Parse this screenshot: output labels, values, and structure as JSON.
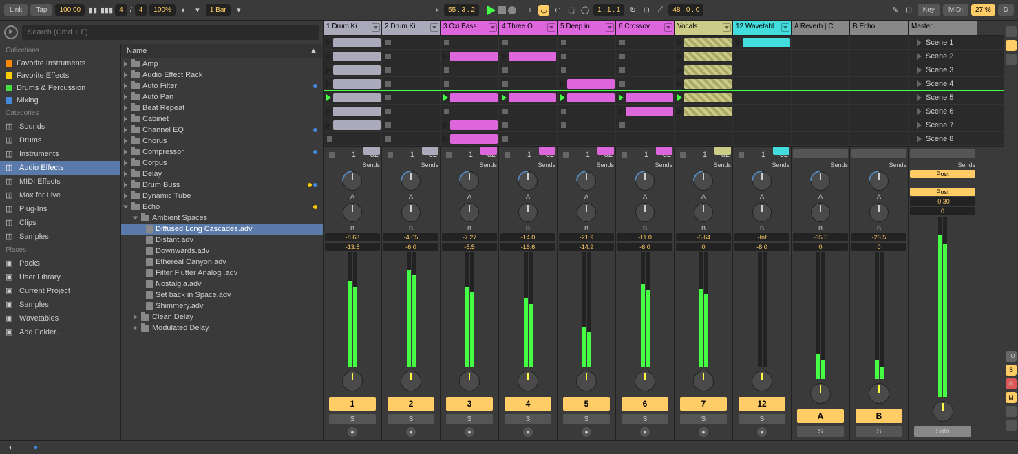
{
  "toolbar": {
    "link": "Link",
    "tap": "Tap",
    "tempo": "100.00",
    "sig_num": "4",
    "sig_sep": "/",
    "sig_den": "4",
    "zoom": "100%",
    "quantize": "1 Bar",
    "position": "55 . 3 . 2",
    "bar_position": "1 . 1 . 1",
    "loop": "48 . 0 . 0",
    "key": "Key",
    "midi": "MIDI",
    "cpu": "27 %",
    "d": "D"
  },
  "search": {
    "placeholder": "Search (Cmd + F)"
  },
  "browser": {
    "collections_header": "Collections",
    "collections": [
      {
        "label": "Favorite Instruments",
        "color": "#f80"
      },
      {
        "label": "Favorite Effects",
        "color": "#fc0"
      },
      {
        "label": "Drums & Percussion",
        "color": "#4d4"
      },
      {
        "label": "Mixing",
        "color": "#48d"
      }
    ],
    "categories_header": "Categories",
    "categories": [
      "Sounds",
      "Drums",
      "Instruments",
      "Audio Effects",
      "MIDI Effects",
      "Max for Live",
      "Plug-Ins",
      "Clips",
      "Samples"
    ],
    "selected_category": "Audio Effects",
    "places_header": "Places",
    "places": [
      "Packs",
      "User Library",
      "Current Project",
      "Samples",
      "Wavetables",
      "Add Folder..."
    ],
    "name_header": "Name",
    "devices": [
      {
        "name": "Amp",
        "dots": []
      },
      {
        "name": "Audio Effect Rack",
        "dots": []
      },
      {
        "name": "Auto Filter",
        "dots": [
          "#48d"
        ]
      },
      {
        "name": "Auto Pan",
        "dots": []
      },
      {
        "name": "Beat Repeat",
        "dots": []
      },
      {
        "name": "Cabinet",
        "dots": []
      },
      {
        "name": "Channel EQ",
        "dots": [
          "#48d"
        ]
      },
      {
        "name": "Chorus",
        "dots": []
      },
      {
        "name": "Compressor",
        "dots": [
          "#48d"
        ]
      },
      {
        "name": "Corpus",
        "dots": []
      },
      {
        "name": "Delay",
        "dots": []
      },
      {
        "name": "Drum Buss",
        "dots": [
          "#fc0",
          "#48d"
        ]
      },
      {
        "name": "Dynamic Tube",
        "dots": []
      },
      {
        "name": "Echo",
        "dots": [
          "#fc0"
        ],
        "open": true
      }
    ],
    "echo_folder": "Ambient Spaces",
    "echo_presets": [
      "Diffused Long Cascades.adv",
      "Distant.adv",
      "Downwards.adv",
      "Ethereal Canyon.adv",
      "Filter Flutter Analog .adv",
      "Nostalgia.adv",
      "Set back in Space.adv",
      "Shimmery.adv"
    ],
    "selected_preset": "Diffused Long Cascades.adv",
    "after_echo": [
      "Clean Delay",
      "Modulated Delay"
    ]
  },
  "tracks": [
    {
      "name": "1 Drum Ki",
      "color": "#aab",
      "num": "1"
    },
    {
      "name": "2 Drum Ki",
      "color": "#aab",
      "num": "2"
    },
    {
      "name": "3 Oxi Bass",
      "color": "#d6d",
      "num": "3"
    },
    {
      "name": "4 Three O",
      "color": "#d6d",
      "num": "4"
    },
    {
      "name": "5 Deep in",
      "color": "#d6d",
      "num": "5"
    },
    {
      "name": "6 Crossov",
      "color": "#d6d",
      "num": "6"
    },
    {
      "name": "Vocals",
      "color": "#cc8",
      "num": "7"
    },
    {
      "name": "12 Wavetabl",
      "color": "#4dd",
      "num": "12"
    }
  ],
  "returns": [
    {
      "name": "A Reverb | C",
      "num": "A"
    },
    {
      "name": "B Echo",
      "num": "B"
    }
  ],
  "master": {
    "name": "Master"
  },
  "scenes": [
    "Scene 1",
    "Scene 2",
    "Scene 3",
    "Scene 4",
    "Scene 5",
    "Scene 6",
    "Scene 7",
    "Scene 8"
  ],
  "clip_grid": [
    [
      {
        "c": "#aab"
      },
      {
        "s": true
      },
      {
        "s": true
      },
      {
        "s": true
      },
      {
        "s": true
      },
      {
        "s": true
      },
      {
        "h": true
      },
      {
        "cy": true
      },
      null,
      null
    ],
    [
      {
        "c": "#aab"
      },
      {
        "s": true
      },
      {
        "c": "#d6d"
      },
      {
        "c": "#d6d"
      },
      {
        "s": true
      },
      {
        "s": true
      },
      {
        "h": true
      },
      {
        "e": true
      },
      null,
      null
    ],
    [
      {
        "c": "#aab"
      },
      {
        "s": true
      },
      {
        "s": true
      },
      {
        "s": true
      },
      {
        "s": true
      },
      {
        "s": true
      },
      {
        "h": true
      },
      {
        "e": true
      },
      null,
      null
    ],
    [
      {
        "c": "#aab"
      },
      {
        "s": true
      },
      {
        "s": true
      },
      {
        "s": true
      },
      {
        "c": "#d6d"
      },
      {
        "s": true
      },
      {
        "h": true
      },
      {
        "e": true
      },
      null,
      null
    ],
    [
      {
        "c": "#aab",
        "p": true
      },
      {
        "p": true,
        "s": true
      },
      {
        "c": "#d6d",
        "p": true
      },
      {
        "c": "#d6d",
        "p": true
      },
      {
        "c": "#d6d",
        "p": true
      },
      {
        "c": "#d6d",
        "p": true
      },
      {
        "h": true,
        "p": true
      },
      {
        "e": true
      },
      null,
      null
    ],
    [
      {
        "c": "#aab"
      },
      {
        "s": true
      },
      {
        "s": true
      },
      {
        "s": true
      },
      {
        "s": true
      },
      {
        "c": "#d6d"
      },
      {
        "h": true
      },
      {
        "e": true
      },
      null,
      null
    ],
    [
      {
        "c": "#aab"
      },
      {
        "s": true
      },
      {
        "c": "#d6d"
      },
      {
        "s": true
      },
      {
        "s": true
      },
      {
        "s": true
      },
      {
        "e": true
      },
      {
        "e": true
      },
      null,
      null
    ],
    [
      {
        "s": true
      },
      {
        "s": true
      },
      {
        "c": "#d6d"
      },
      {
        "s": true
      },
      {
        "e": true
      },
      {
        "e": true
      },
      {
        "e": true
      },
      {
        "e": true
      },
      null,
      null
    ]
  ],
  "mixer": {
    "loop_label": "32",
    "loop_num": "1",
    "sends_label": "Sends",
    "send_a": "A",
    "send_b": "B",
    "s_label": "S",
    "solo_label": "Solo",
    "post_label": "Post",
    "tracks": [
      {
        "vol": "-8.63",
        "send": "-13.5",
        "meter": 75,
        "marker": "#aab"
      },
      {
        "vol": "-4.65",
        "send": "-6.0",
        "meter": 85,
        "marker": "#aab"
      },
      {
        "vol": "-7.27",
        "send": "-5.5",
        "meter": 70,
        "marker": "#d6d"
      },
      {
        "vol": "-14.0",
        "send": "-18.6",
        "meter": 60,
        "marker": "#d6d"
      },
      {
        "vol": "-21.9",
        "send": "-14.9",
        "meter": 35,
        "marker": "#d6d"
      },
      {
        "vol": "-11.0",
        "send": "-6.0",
        "meter": 72,
        "marker": "#d6d"
      },
      {
        "vol": "-6.64",
        "send": "0",
        "meter": 68,
        "marker": "#cc8"
      },
      {
        "vol": "-Inf",
        "send": "-8.0",
        "meter": 0,
        "marker": "#4dd"
      },
      {
        "vol": "-35.5",
        "send": "0",
        "meter": 20
      },
      {
        "vol": "-23.5",
        "send": "0",
        "meter": 15
      }
    ],
    "master": {
      "vol": "-0.30",
      "send": "0",
      "meter": 90
    },
    "scale": [
      "6",
      "0",
      "6",
      "12",
      "18",
      "24",
      "30",
      "36",
      "42",
      "48",
      "54",
      "60"
    ]
  }
}
